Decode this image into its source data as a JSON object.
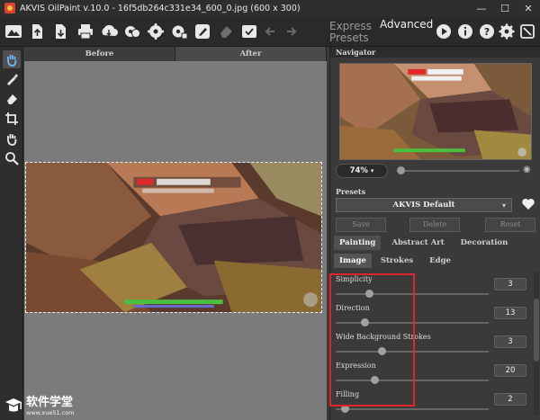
{
  "window": {
    "title": "AKVIS OilPaint v.10.0 - 16f5db264c331e34_600_0.jpg (600 x 300)",
    "minimize": "—",
    "maximize": "☐",
    "close": "✕"
  },
  "toolbar": {
    "icons": [
      "home-icon",
      "open-file-icon",
      "save-file-icon",
      "print-icon",
      "share-icon",
      "batch-icon",
      "settings-gear-icon",
      "gear-plus-icon",
      "brush-icon",
      "eraser-disabled-icon",
      "apply-icon",
      "undo-icon",
      "redo-icon",
      "run-icon",
      "info-icon",
      "help-icon",
      "preferences-icon",
      "notifications-icon"
    ],
    "mode_express": "Express",
    "mode_presets": "Presets",
    "mode_advanced": "Advanced"
  },
  "tools": [
    "hand-icon",
    "brush-icon",
    "eraser-icon",
    "crop-icon",
    "pan-icon",
    "zoom-icon"
  ],
  "view": {
    "before": "Before",
    "after": "After"
  },
  "navigator": {
    "title": "Navigator",
    "zoom": "74%"
  },
  "presets": {
    "title": "Presets",
    "selected": "AKVIS Default",
    "save": "Save",
    "delete": "Delete",
    "reset": "Reset"
  },
  "tabs": {
    "painting": "Painting",
    "abstract_art": "Abstract Art",
    "decoration": "Decoration"
  },
  "subtabs": {
    "image": "Image",
    "strokes": "Strokes",
    "edge": "Edge"
  },
  "params": [
    {
      "label": "Simplicity",
      "value": "3",
      "level": 0.22
    },
    {
      "label": "Direction",
      "value": "13",
      "level": 0.19
    },
    {
      "label": "Wide Background Strokes",
      "value": "3",
      "level": 0.3
    },
    {
      "label": "Expression",
      "value": "20",
      "level": 0.25
    },
    {
      "label": "Filling",
      "value": "2",
      "level": 0.06
    }
  ],
  "watermark": {
    "name": "软件学堂",
    "url": "www.xue51.com"
  },
  "colors": {
    "accent_highlight": "#e0242c",
    "panel_bg": "#3a3a3a",
    "canvas_bg": "#7b7b7b"
  }
}
